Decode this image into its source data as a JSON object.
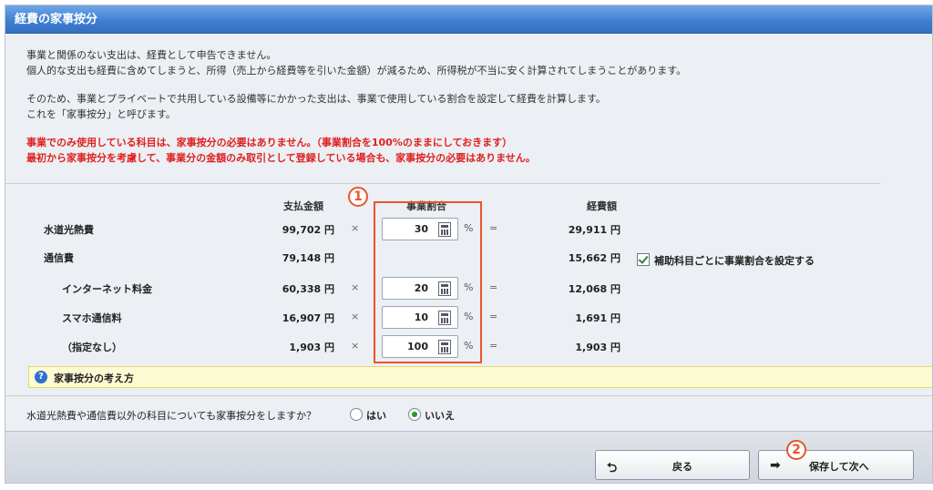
{
  "header": {
    "title": "経費の家事按分"
  },
  "intro": {
    "lines1": [
      "事業と関係のない支出は、経費として申告できません。",
      "個人的な支出も経費に含めてしまうと、所得（売上から経費等を引いた金額）が減るため、所得税が不当に安く計算されてしまうことがあります。"
    ],
    "lines2": [
      "そのため、事業とプライベートで共用している設備等にかかった支出は、事業で使用している割合を設定して経費を計算します。",
      "これを「家事按分」と呼びます。"
    ],
    "warn": [
      "事業でのみ使用している科目は、家事按分の必要はありません。（事業割合を100%のままにしておきます）",
      "最初から家事按分を考慮して、事業分の金額のみ取引として登録している場合も、家事按分の必要はありません。"
    ]
  },
  "columns": {
    "amount": "支払金額",
    "ratio": "事業割合",
    "expense": "経費額"
  },
  "rows": [
    {
      "name": "水道光熱費",
      "amount": "99,702 円",
      "times": "×",
      "ratio": "30",
      "pct": "%",
      "eq": "=",
      "expense": "29,911 円"
    },
    {
      "name": "通信費",
      "amount": "79,148 円",
      "expense": "15,662 円"
    },
    {
      "name": "インターネット料金",
      "amount": "60,338 円",
      "times": "×",
      "ratio": "20",
      "pct": "%",
      "eq": "=",
      "expense": "12,068 円"
    },
    {
      "name": "スマホ通信料",
      "amount": "16,907 円",
      "times": "×",
      "ratio": "10",
      "pct": "%",
      "eq": "=",
      "expense": "1,691 円"
    },
    {
      "name": "（指定なし）",
      "amount": "1,903 円",
      "times": "×",
      "ratio": "100",
      "pct": "%",
      "eq": "=",
      "expense": "1,903 円"
    }
  ],
  "subaccount_checkbox": {
    "label": "補助科目ごとに事業割合を設定する",
    "checked": true
  },
  "hint": {
    "label": "家事按分の考え方",
    "icon": "?"
  },
  "question": {
    "text": "水道光熱費や通信費以外の科目についても家事按分をしますか？",
    "yes": "はい",
    "no": "いいえ",
    "selected": "no"
  },
  "buttons": {
    "back": "戻る",
    "next": "保存して次へ",
    "back_icon": "⮌",
    "next_icon": "➡"
  },
  "badges": {
    "one": "1",
    "two": "2"
  }
}
